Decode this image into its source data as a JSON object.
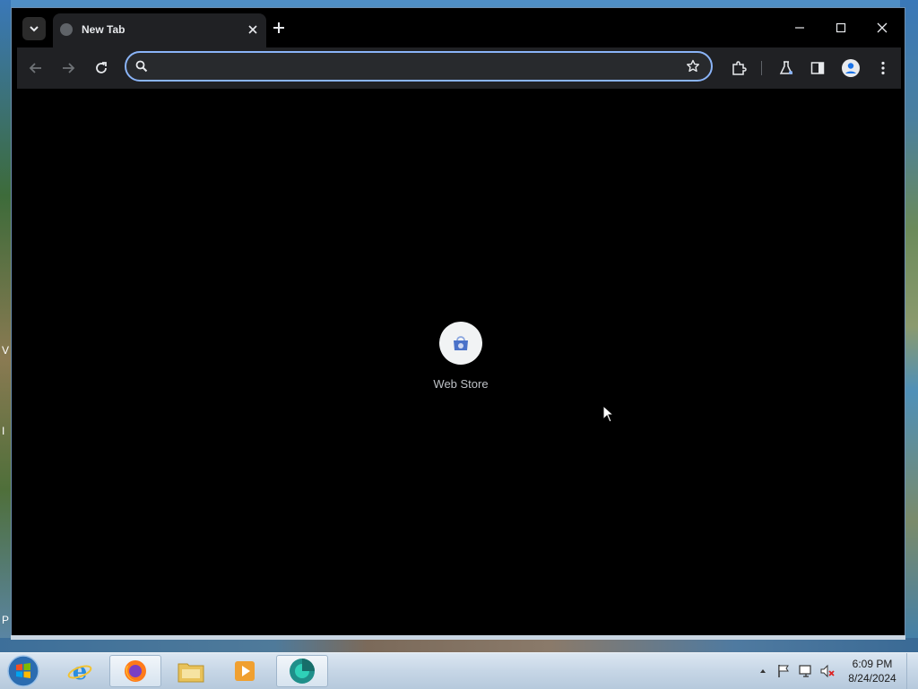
{
  "browser": {
    "tab": {
      "title": "New Tab"
    },
    "omnibox": {
      "value": "",
      "placeholder": ""
    },
    "accent_color": "#8ab4f8",
    "background_color": "#000000"
  },
  "newtab": {
    "shortcuts": [
      {
        "label": "Web Store",
        "icon": "web-store-icon"
      }
    ]
  },
  "desktop": {
    "edge_letters": [
      "V",
      "I",
      "P"
    ]
  },
  "taskbar": {
    "apps": [
      {
        "name": "internet-explorer",
        "icon": "ie-icon"
      },
      {
        "name": "firefox",
        "icon": "firefox-icon"
      },
      {
        "name": "file-explorer",
        "icon": "folder-icon"
      },
      {
        "name": "media-player",
        "icon": "media-player-icon"
      },
      {
        "name": "browser",
        "icon": "browser-app-icon",
        "active": true
      }
    ],
    "clock": {
      "time": "6:09 PM",
      "date": "8/24/2024"
    }
  }
}
